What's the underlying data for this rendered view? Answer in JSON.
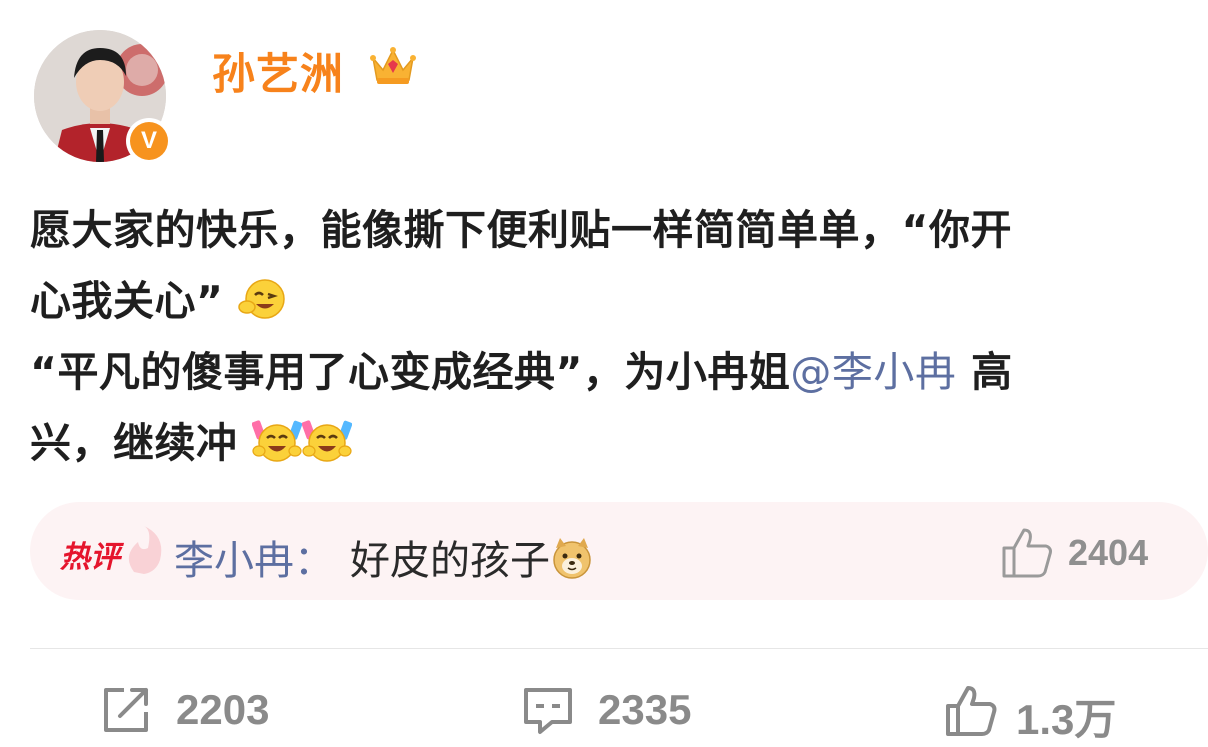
{
  "post": {
    "author": {
      "name": "孙艺洲",
      "verified_mark": "V",
      "crown_icon": "crown-vip-icon",
      "avatar_icon": "user-avatar"
    },
    "text": {
      "line1": "愿大家的快乐，能像撕下便利贴一样简简单单，“你开",
      "line2": "心我关心”",
      "line3_part1": "“平凡的傻事用了心变成经典”，为小冉姐",
      "mention": "@李小冉",
      "line3_part2": " 高",
      "line4": "兴，继续冲"
    },
    "emojis": [
      "wink-laugh-emoji",
      "cheering-emoji",
      "cheering-emoji"
    ]
  },
  "hot_comment": {
    "badge": "热评",
    "author": "李小冉：",
    "text": "好皮的孩子",
    "emoji": "doge-emoji",
    "like_count": "2404",
    "like_icon": "thumbs-up-icon"
  },
  "actions": {
    "repost": {
      "icon": "repost-icon",
      "count": "2203"
    },
    "comment": {
      "icon": "comment-icon",
      "count": "2335"
    },
    "like": {
      "icon": "thumbs-up-icon",
      "count": "1.3万"
    }
  },
  "colors": {
    "username": "#f7821b",
    "mention": "#5d6fa1",
    "hot_badge": "#e5152d",
    "hot_comment_bg": "#fdf3f4",
    "counts": "#8a8a8a"
  }
}
